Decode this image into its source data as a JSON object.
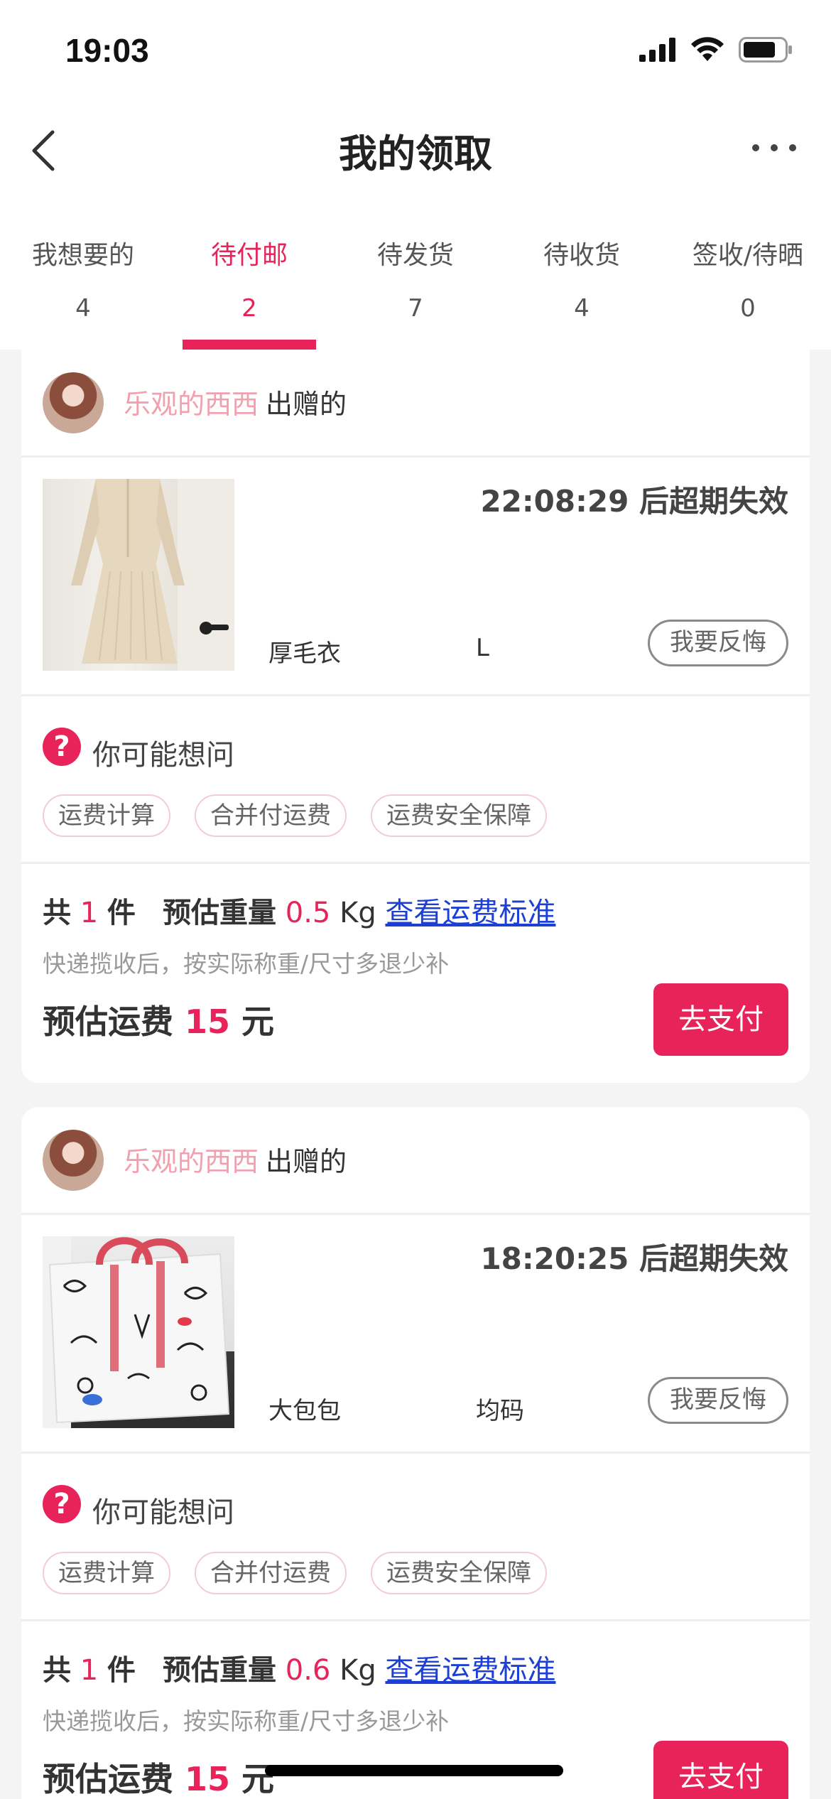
{
  "status_bar": {
    "time": "19:03"
  },
  "nav": {
    "title": "我的领取"
  },
  "tabs": [
    {
      "label": "我想要的",
      "count": "4"
    },
    {
      "label": "待付邮",
      "count": "2"
    },
    {
      "label": "待发货",
      "count": "7"
    },
    {
      "label": "待收货",
      "count": "4"
    },
    {
      "label": "签收/待晒",
      "count": "0"
    }
  ],
  "colors": {
    "accent": "#e8235a",
    "link": "#1c3fd6",
    "donor_name": "#f0a0ae"
  },
  "orders": [
    {
      "donor_name": "乐观的西西",
      "donor_suffix": "出赠的",
      "countdown": "22:08:29 后超期失效",
      "item_name": "厚毛衣",
      "item_size": "L",
      "regret_label": "我要反悔",
      "faq_title": "你可能想问",
      "faq_chips": [
        "运费计算",
        "合并付运费",
        "运费安全保障"
      ],
      "count_prefix": "共",
      "count": "1",
      "count_suffix": "件",
      "weight_label": "预估重量",
      "weight": "0.5",
      "weight_unit": "Kg",
      "fee_standard_link": "查看运费标准",
      "note": "快递揽收后，按实际称重/尺寸多退少补",
      "fee_label": "预估运费",
      "fee": "15",
      "fee_unit": "元",
      "pay_label": "去支付"
    },
    {
      "donor_name": "乐观的西西",
      "donor_suffix": "出赠的",
      "countdown": "18:20:25 后超期失效",
      "item_name": "大包包",
      "item_size": "均码",
      "regret_label": "我要反悔",
      "faq_title": "你可能想问",
      "faq_chips": [
        "运费计算",
        "合并付运费",
        "运费安全保障"
      ],
      "count_prefix": "共",
      "count": "1",
      "count_suffix": "件",
      "weight_label": "预估重量",
      "weight": "0.6",
      "weight_unit": "Kg",
      "fee_standard_link": "查看运费标准",
      "note": "快递揽收后，按实际称重/尺寸多退少补",
      "fee_label": "预估运费",
      "fee": "15",
      "fee_unit": "元",
      "pay_label": "去支付"
    }
  ]
}
